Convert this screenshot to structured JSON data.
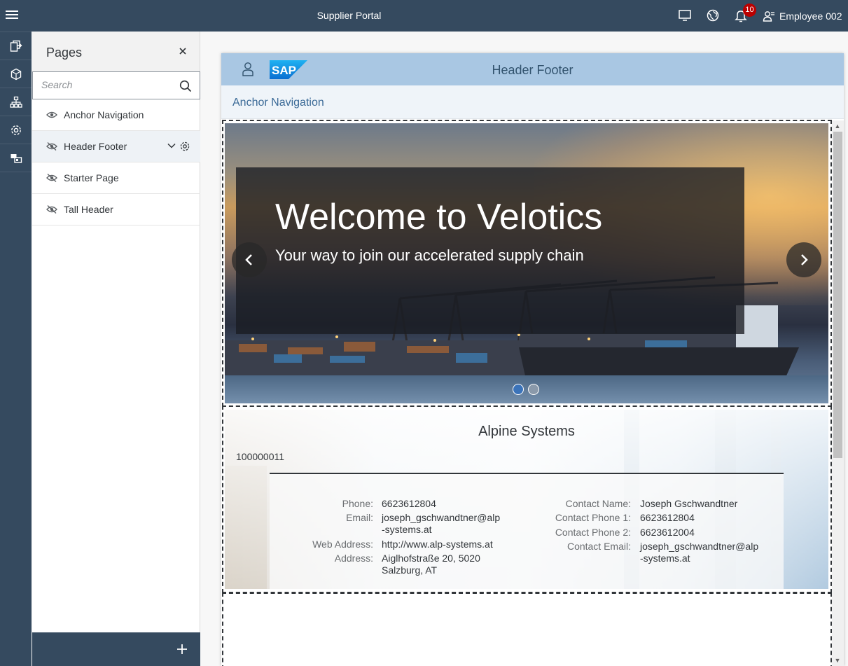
{
  "shell": {
    "title": "Supplier Portal",
    "notification_count": "10",
    "user_name": "Employee 002"
  },
  "rail": {
    "items": [
      "pages-icon",
      "cube-icon",
      "sitemap-icon",
      "settings-icon",
      "theme-icon"
    ]
  },
  "pages_panel": {
    "title": "Pages",
    "search_placeholder": "Search",
    "items": [
      {
        "label": "Anchor Navigation",
        "visibility": "visible"
      },
      {
        "label": "Header Footer",
        "visibility": "hidden",
        "selected": true
      },
      {
        "label": "Starter Page",
        "visibility": "hidden"
      },
      {
        "label": "Tall Header",
        "visibility": "hidden"
      }
    ]
  },
  "canvas": {
    "header_title": "Header Footer",
    "logo_text": "SAP",
    "anchor_link": "Anchor Navigation",
    "hero": {
      "title": "Welcome to Velotics",
      "subtitle": "Your way to join our accelerated supply chain",
      "slide_count": 2,
      "active_slide": 1
    },
    "supplier": {
      "name": "Alpine Systems",
      "id": "100000011",
      "left": [
        {
          "label": "Phone:",
          "value": "6623612804"
        },
        {
          "label": "Email:",
          "value1": "joseph_gschwandtner@alp",
          "value2": "-systems.at"
        },
        {
          "label": "Web Address:",
          "value": "http://www.alp-systems.at"
        },
        {
          "label": "Address:",
          "value1": "Aiglhofstraße 20, 5020",
          "value2": "Salzburg, AT"
        }
      ],
      "right": [
        {
          "label": "Contact Name:",
          "value": "Joseph Gschwandtner"
        },
        {
          "label": "Contact Phone 1:",
          "value": "6623612804"
        },
        {
          "label": "Contact Phone 2:",
          "value": "6623612004"
        },
        {
          "label": "Contact Email:",
          "value1": "joseph_gschwandtner@alp",
          "value2": "-systems.at"
        }
      ]
    }
  },
  "colors": {
    "shell": "#354a5f",
    "canvas_header": "#a9c7e3",
    "link": "#3b6a97",
    "badge": "#bb0000"
  }
}
